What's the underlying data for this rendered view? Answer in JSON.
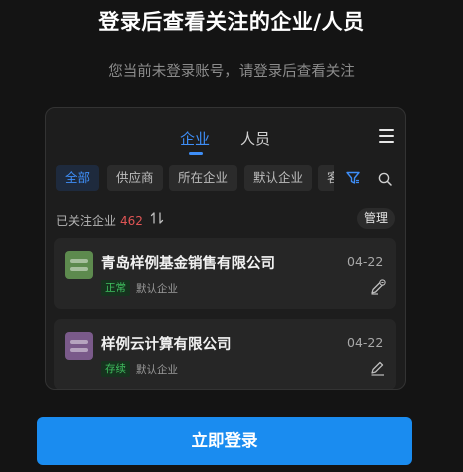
{
  "header": {
    "title": "登录后查看关注的企业/人员",
    "subtitle": "您当前未登录账号，请登录后查看关注"
  },
  "preview": {
    "tabs": [
      {
        "label": "企业",
        "active": true
      },
      {
        "label": "人员",
        "active": false
      }
    ],
    "filters": [
      {
        "label": "全部",
        "active": true
      },
      {
        "label": "供应商",
        "active": false
      },
      {
        "label": "所在企业",
        "active": false
      },
      {
        "label": "默认企业",
        "active": false
      },
      {
        "label": "客",
        "active": false
      }
    ],
    "followed_label": "已关注企业",
    "followed_count": "462",
    "manage_label": "管理",
    "cards": [
      {
        "company": "青岛样例基金销售有限公司",
        "status": "正常",
        "group": "默认企业",
        "date": "04-22",
        "logo_color": "#5d8a4e",
        "edit_icon": "pencil-ai-icon"
      },
      {
        "company": "样例云计算有限公司",
        "status": "存续",
        "group": "默认企业",
        "date": "04-22",
        "logo_color": "#7a5a8a",
        "edit_icon": "pencil-icon"
      }
    ]
  },
  "login_button": {
    "label": "立即登录",
    "color": "#1a8cf0"
  },
  "colors": {
    "accent": "#3e8ef7",
    "count": "#e05555",
    "status_green": "#3fbf5f"
  }
}
